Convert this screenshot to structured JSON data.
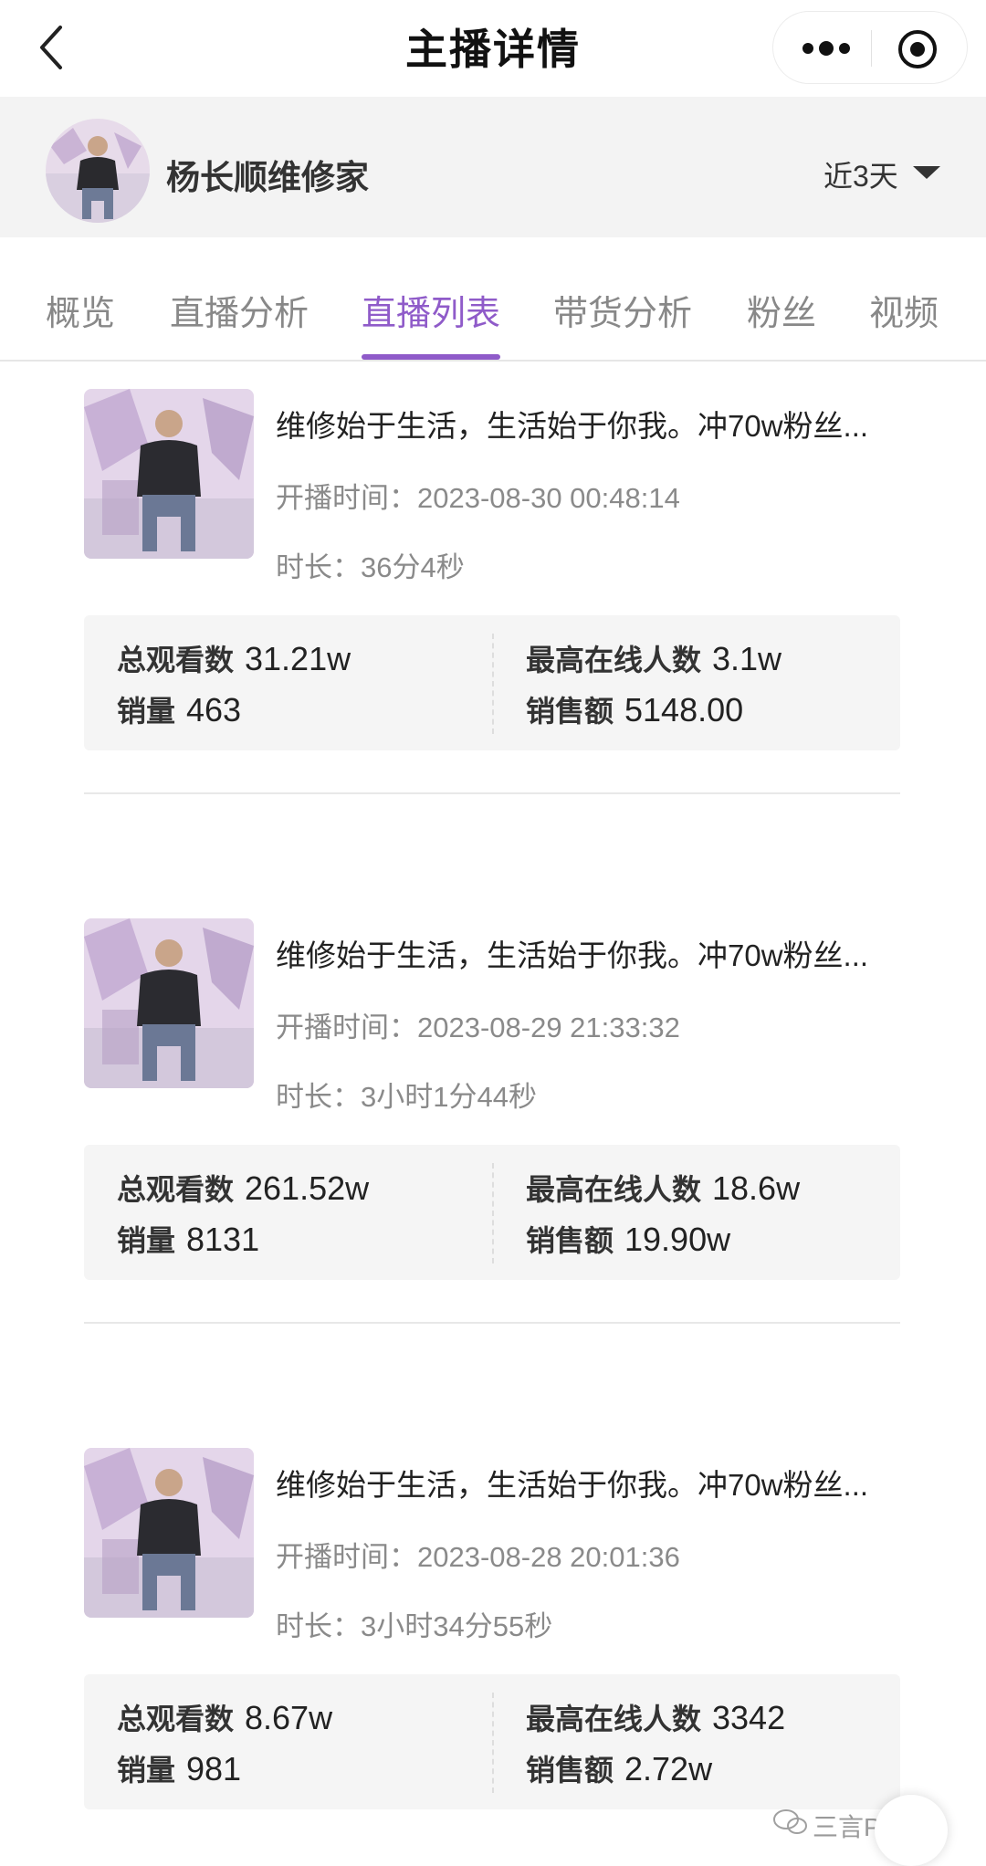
{
  "nav": {
    "title": "主播详情"
  },
  "anchor": {
    "name": "杨长顺维修家",
    "period": "近3天"
  },
  "tabs": [
    {
      "label": "概览"
    },
    {
      "label": "直播分析"
    },
    {
      "label": "直播列表",
      "active": true
    },
    {
      "label": "带货分析"
    },
    {
      "label": "粉丝"
    },
    {
      "label": "视频"
    }
  ],
  "lives": [
    {
      "title": "维修始于生活，生活始于你我。冲70w粉丝...",
      "start_label": "开播时间：",
      "start_time": "2023-08-30 00:48:14",
      "duration_label": "时长：",
      "duration": "36分4秒",
      "views_label": "总观看数",
      "views": "31.21w",
      "peak_label": "最高在线人数",
      "peak": "3.1w",
      "sales_label": "销量",
      "sales": "463",
      "revenue_label": "销售额",
      "revenue": "5148.00"
    },
    {
      "title": "维修始于生活，生活始于你我。冲70w粉丝...",
      "start_label": "开播时间：",
      "start_time": "2023-08-29 21:33:32",
      "duration_label": "时长：",
      "duration": "3小时1分44秒",
      "views_label": "总观看数",
      "views": "261.52w",
      "peak_label": "最高在线人数",
      "peak": "18.6w",
      "sales_label": "销量",
      "sales": "8131",
      "revenue_label": "销售额",
      "revenue": "19.90w"
    },
    {
      "title": "维修始于生活，生活始于你我。冲70w粉丝...",
      "start_label": "开播时间：",
      "start_time": "2023-08-28 20:01:36",
      "duration_label": "时长：",
      "duration": "3小时34分55秒",
      "views_label": "总观看数",
      "views": "8.67w",
      "peak_label": "最高在线人数",
      "peak": "3342",
      "sales_label": "销量",
      "sales": "981",
      "revenue_label": "销售额",
      "revenue": "2.72w"
    }
  ],
  "watermark": "三言Pro",
  "colors": {
    "accent": "#8f5bc9",
    "header_bg": "#f3f3f3",
    "stats_bg": "#f5f5f5"
  }
}
